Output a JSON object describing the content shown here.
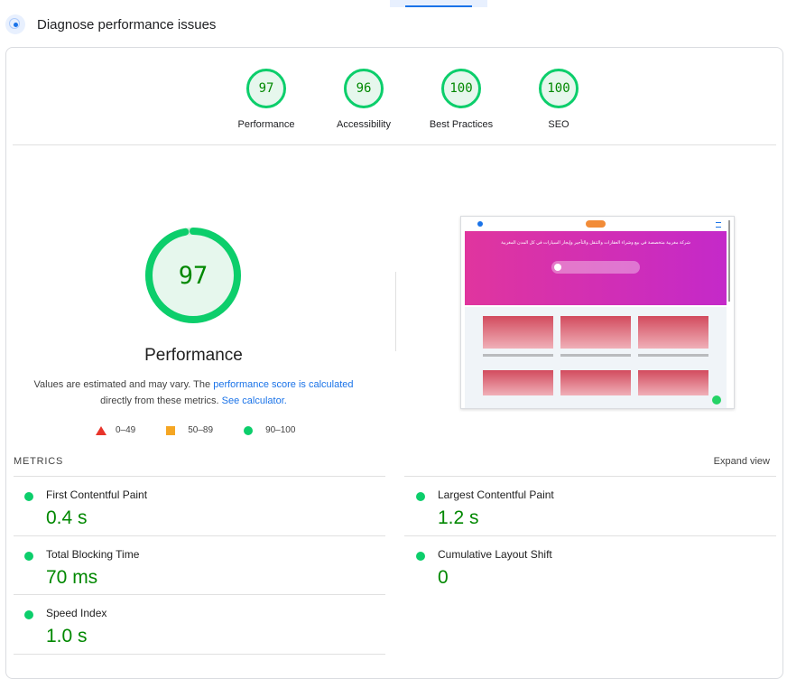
{
  "header": {
    "title": "Diagnose performance issues"
  },
  "gauges": [
    {
      "score": "97",
      "label": "Performance"
    },
    {
      "score": "96",
      "label": "Accessibility"
    },
    {
      "score": "100",
      "label": "Best Practices"
    },
    {
      "score": "100",
      "label": "SEO"
    }
  ],
  "performance": {
    "score": "97",
    "score_value": 97,
    "title": "Performance",
    "desc_prefix": "Values are estimated and may vary. The ",
    "desc_link1": "performance score is calculated",
    "desc_middle": " directly from these metrics. ",
    "desc_link2": "See calculator.",
    "legend": [
      {
        "range": "0–49",
        "shape": "triangle",
        "color": "#e8342a"
      },
      {
        "range": "50–89",
        "shape": "square",
        "color": "#f5a623"
      },
      {
        "range": "90–100",
        "shape": "circle",
        "color": "#0cce6b"
      }
    ]
  },
  "preview": {
    "hero_text": "شركة مغربية متخصصة في بيع وشراء العقارات والتنقل والتأجير وإيجار السيارات في كل المدن المغربية"
  },
  "metrics": {
    "label": "METRICS",
    "expand": "Expand view",
    "items": [
      {
        "name": "First Contentful Paint",
        "value": "0.4 s"
      },
      {
        "name": "Largest Contentful Paint",
        "value": "1.2 s"
      },
      {
        "name": "Total Blocking Time",
        "value": "70 ms"
      },
      {
        "name": "Cumulative Layout Shift",
        "value": "0"
      },
      {
        "name": "Speed Index",
        "value": "1.0 s"
      }
    ]
  },
  "colors": {
    "good": "#0cce6b",
    "good_text": "#008800",
    "accent": "#1a73e8"
  }
}
